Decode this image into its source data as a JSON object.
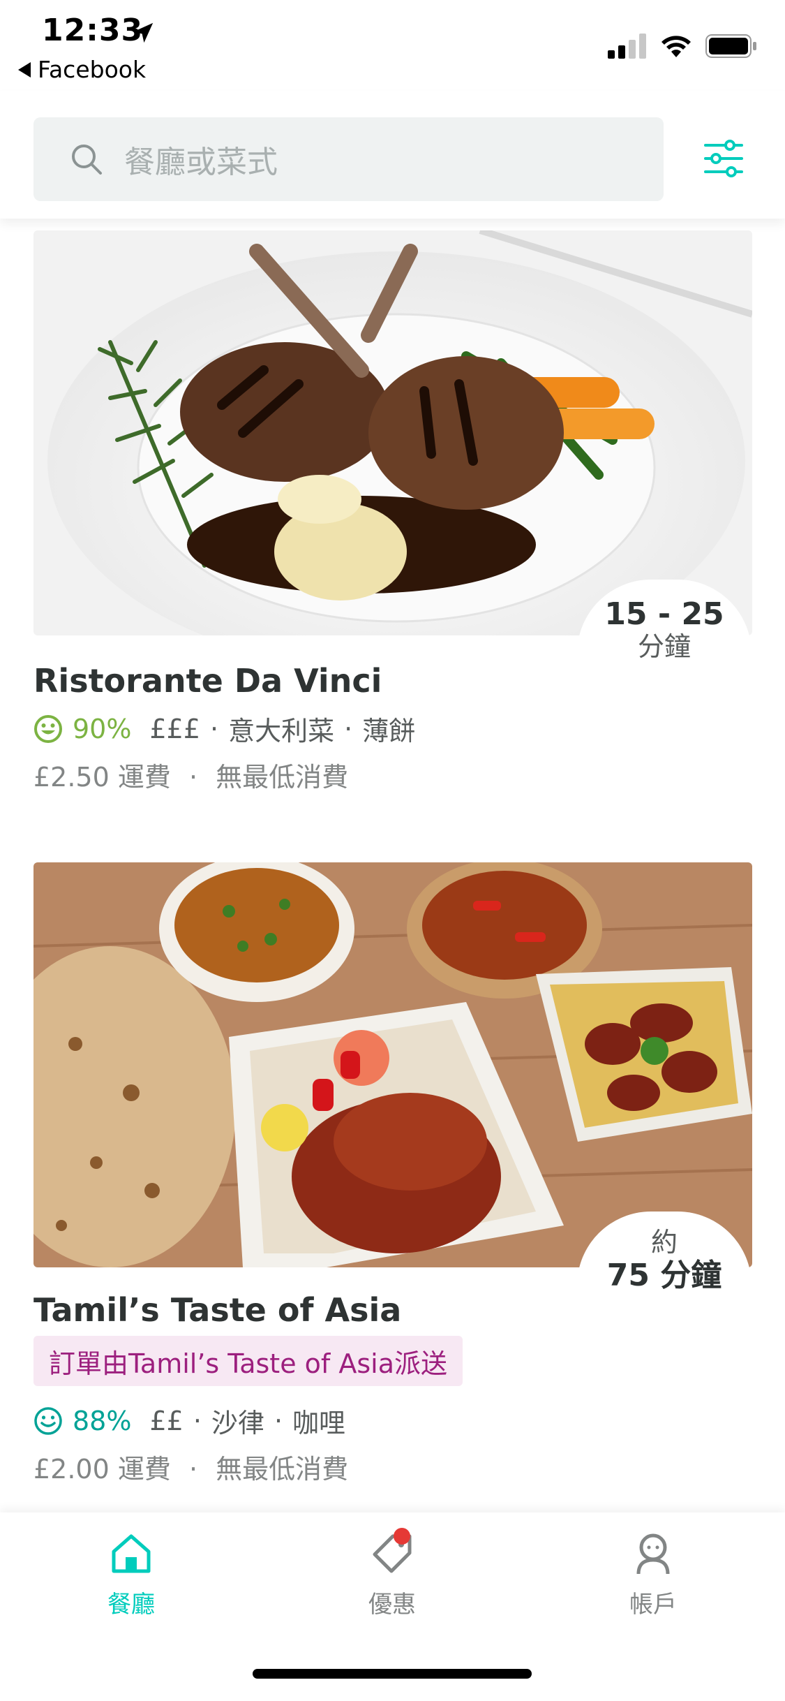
{
  "status_bar": {
    "time": "12:33",
    "back_label": "Facebook"
  },
  "search": {
    "placeholder": "餐廳或菜式"
  },
  "restaurants": [
    {
      "time_main": "15 - 25",
      "time_unit": "分鐘",
      "name": "Ristorante Da Vinci",
      "rating": "90%",
      "price": "£££",
      "cuisine1": "意大利菜",
      "cuisine2": "薄餅",
      "fee": "£2.50 運費",
      "min_order": "無最低消費"
    },
    {
      "time_prefix": "約",
      "time_main": "75 分鐘",
      "name": "Tamil’s Taste of Asia",
      "delivery_tag": "訂單由Tamil’s Taste of Asia派送",
      "rating": "88%",
      "price": "££",
      "cuisine1": "沙律",
      "cuisine2": "咖哩",
      "fee": "£2.00 運費",
      "min_order": "無最低消費"
    }
  ],
  "bottom_nav": [
    {
      "label": "餐廳",
      "icon": "home-icon"
    },
    {
      "label": "優惠",
      "icon": "tag-icon"
    },
    {
      "label": "帳戶",
      "icon": "account-icon"
    }
  ],
  "colors": {
    "accent": "#00ccbc",
    "rating_green": "#7cb342",
    "rating_teal": "#00a296",
    "tag_text": "#9c1f7e",
    "tag_bg": "#f7e8f3"
  }
}
